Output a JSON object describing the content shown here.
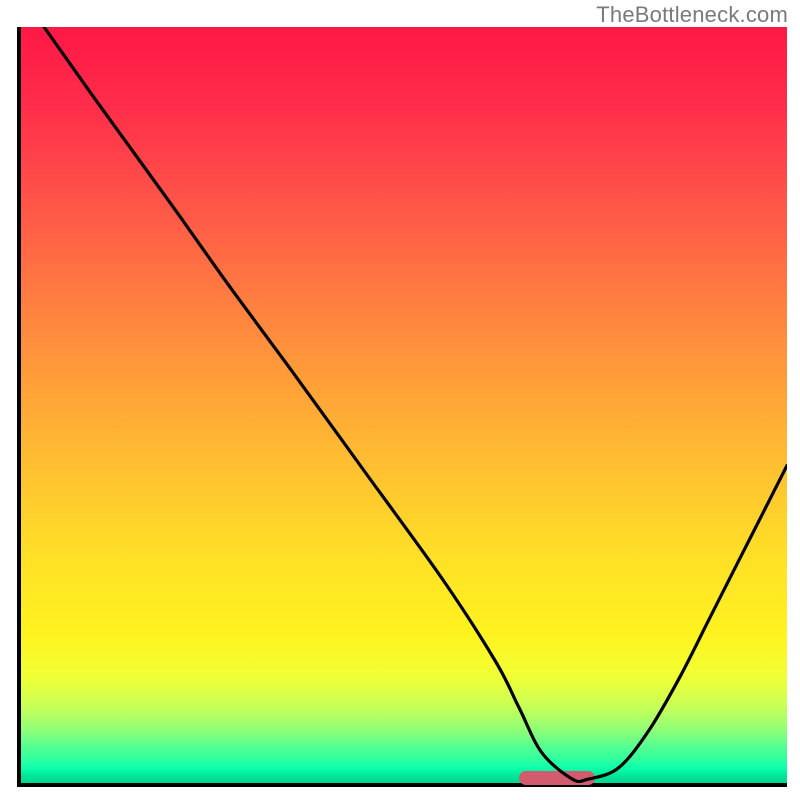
{
  "watermark": "TheBottleneck.com",
  "chart_data": {
    "type": "line",
    "title": "",
    "xlabel": "",
    "ylabel": "",
    "xlim": [
      0,
      100
    ],
    "ylim": [
      0,
      100
    ],
    "grid": false,
    "legend": false,
    "series": [
      {
        "name": "bottleneck-curve",
        "x": [
          3,
          10,
          20,
          27,
          35,
          45,
          55,
          62,
          65,
          68,
          72,
          74,
          78,
          82,
          86,
          90,
          94,
          98,
          100
        ],
        "y": [
          100,
          90,
          76,
          66,
          55,
          41,
          27,
          16,
          10,
          4,
          0.5,
          0.5,
          2,
          7,
          14,
          22,
          30,
          38,
          42
        ]
      }
    ],
    "annotations": [
      {
        "name": "optimal-range-pill",
        "x_start": 65,
        "x_end": 75,
        "y": 0.7
      }
    ],
    "gradient": {
      "type": "vertical",
      "stops": [
        {
          "pos": 0.0,
          "color": "#ff1846"
        },
        {
          "pos": 0.25,
          "color": "#ff5a47"
        },
        {
          "pos": 0.55,
          "color": "#ffb733"
        },
        {
          "pos": 0.8,
          "color": "#fff21f"
        },
        {
          "pos": 0.93,
          "color": "#8fff77"
        },
        {
          "pos": 1.0,
          "color": "#00d68f"
        }
      ]
    }
  }
}
